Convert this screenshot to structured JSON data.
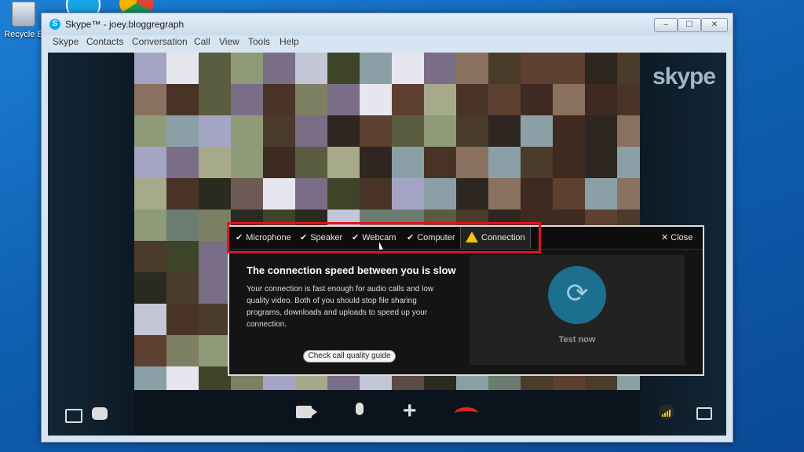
{
  "desktop": {
    "recycle_label": "Recycle B"
  },
  "window": {
    "title": "Skype™ - joey.bloggregraph",
    "min_glyph": "–",
    "max_glyph": "☐",
    "close_glyph": "✕"
  },
  "menu": [
    "Skype",
    "Contacts",
    "Conversation",
    "Call",
    "View",
    "Tools",
    "Help"
  ],
  "call": {
    "brand": "skype"
  },
  "popup": {
    "tabs": [
      "Microphone",
      "Speaker",
      "Webcam",
      "Computer"
    ],
    "active_tab": "Connection",
    "close_label": "Close",
    "heading": "The connection speed between you is slow",
    "body": "Your connection is fast enough for audio calls and low quality video. Both of you should stop file sharing programs, downloads and uploads to speed up your connection.",
    "guide_button": "Check call quality guide",
    "test_label": "Test now"
  },
  "colors": {
    "highlight": "#e0141e",
    "warning": "#f6c20a",
    "end_call": "#e0261e",
    "signal": "#f1c40f"
  }
}
